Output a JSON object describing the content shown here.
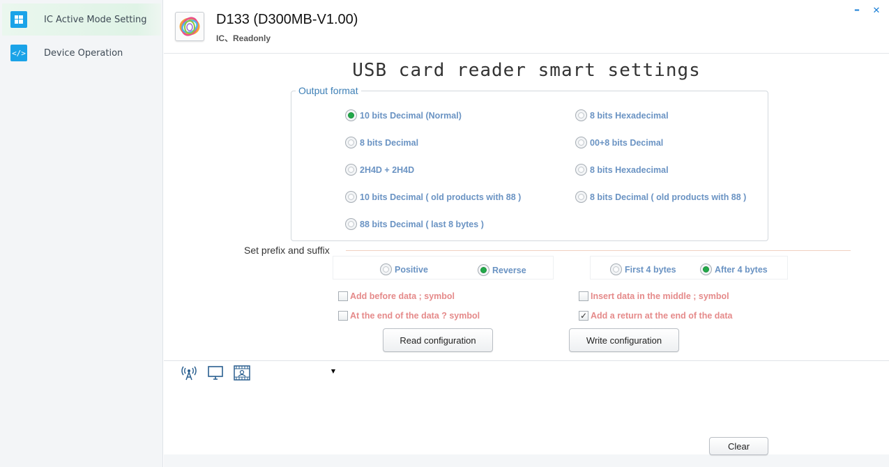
{
  "sidebar": {
    "items": [
      {
        "label": "IC Active Mode Setting",
        "icon": "windows-icon",
        "active": true
      },
      {
        "label": "Device Operation",
        "icon": "code-icon",
        "active": false
      }
    ]
  },
  "header": {
    "title": "D133 (D300MB-V1.00)",
    "subtitle": "IC、Readonly",
    "minimize": "–",
    "close": "✕"
  },
  "main": {
    "title": "USB card reader smart settings",
    "output_format": {
      "legend": "Output format",
      "options": [
        {
          "label": "10 bits Decimal (Normal)",
          "selected": true
        },
        {
          "label": "8 bits Hexadecimal",
          "selected": false
        },
        {
          "label": "8 bits Decimal",
          "selected": false
        },
        {
          "label": "00+8 bits Decimal",
          "selected": false
        },
        {
          "label": "2H4D + 2H4D",
          "selected": false
        },
        {
          "label": "8 bits Hexadecimal",
          "selected": false
        },
        {
          "label": "10 bits Decimal ( old products with 88 )",
          "selected": false
        },
        {
          "label": "8 bits Decimal ( old products with 88 )",
          "selected": false
        },
        {
          "label": "88 bits Decimal ( last 8 bytes )",
          "selected": false
        }
      ]
    },
    "prefix_suffix": {
      "label": "Set prefix and suffix",
      "order": [
        {
          "label": "Positive",
          "selected": false
        },
        {
          "label": "Reverse",
          "selected": true
        }
      ],
      "bytes": [
        {
          "label": "First 4 bytes",
          "selected": false
        },
        {
          "label": "After 4 bytes",
          "selected": true
        }
      ],
      "checks": [
        {
          "label": "Add before data ; symbol",
          "checked": false
        },
        {
          "label": "Insert data in the middle ; symbol",
          "checked": false
        },
        {
          "label": "At the end of the data ? symbol",
          "checked": false
        },
        {
          "label": "Add a return at the end of the data",
          "checked": true
        }
      ]
    },
    "buttons": {
      "read": "Read configuration",
      "write": "Write configuration"
    }
  },
  "bottom": {
    "tools": [
      "antenna-icon",
      "monitor-icon",
      "film-icon"
    ],
    "combo_value": "",
    "clear": "Clear"
  },
  "colors": {
    "accent_blue": "#1aa3e8",
    "option_text": "#6a93c3",
    "check_text": "#e58a8a",
    "selected_radio": "#23a94a"
  }
}
